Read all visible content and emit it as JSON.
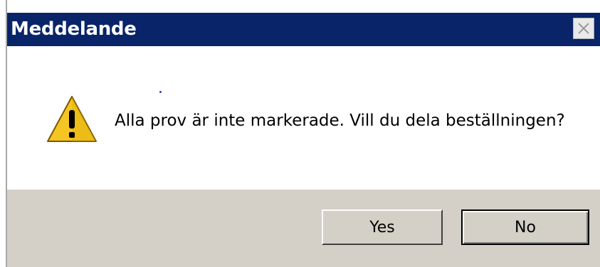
{
  "window": {
    "title": "Meddelande",
    "close_icon": "close-icon"
  },
  "message": {
    "icon": "warning-icon",
    "text": "Alla prov är inte markerade. Vill du dela beställningen?"
  },
  "buttons": {
    "yes_label": "Yes",
    "no_label": "No"
  },
  "colors": {
    "titlebar": "#0a246a",
    "button_bar": "#d4d0c8",
    "warning_fill": "#f5c623"
  }
}
